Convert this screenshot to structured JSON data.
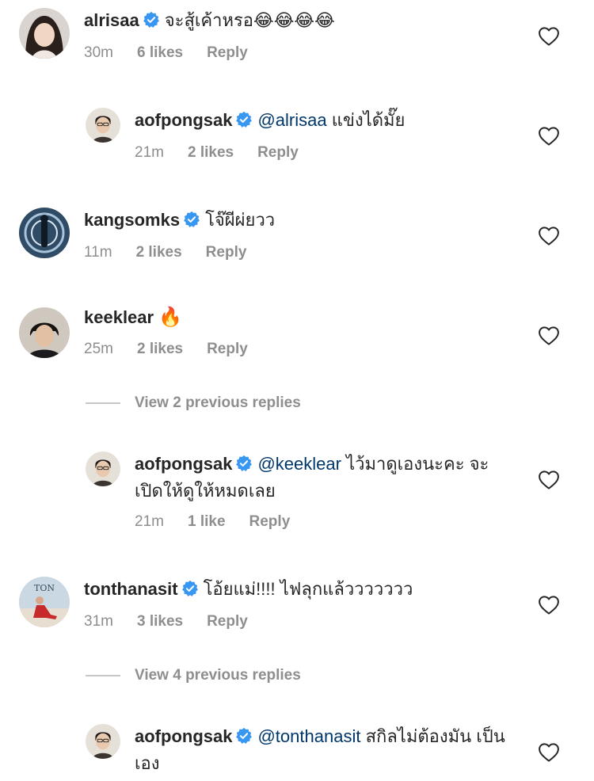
{
  "colors": {
    "text": "#262626",
    "secondary": "#8e8e8e",
    "mention": "#00376b",
    "verified": "#3897f0",
    "background": "#ffffff"
  },
  "comments": [
    {
      "username": "alrisaa",
      "verified": true,
      "text": "จะสู้เค้าหรอ😂😂😂😂",
      "time": "30m",
      "likes": "6 likes",
      "reply": "Reply"
    },
    {
      "username": "aofpongsak",
      "verified": true,
      "mention": "@alrisaa",
      "text": "แข่งได้มั๊ย",
      "time": "21m",
      "likes": "2 likes",
      "reply": "Reply"
    },
    {
      "username": "kangsomks",
      "verified": true,
      "text": "โจ๊ผีผ่ยวว",
      "time": "11m",
      "likes": "2 likes",
      "reply": "Reply"
    },
    {
      "username": "keeklear",
      "verified": false,
      "text": "🔥",
      "time": "25m",
      "likes": "2 likes",
      "reply": "Reply"
    },
    {
      "username": "aofpongsak",
      "verified": true,
      "mention": "@keeklear",
      "text": "ไว้มาดูเองนะคะ จะเปิดให้ดูให้หมดเลย",
      "time": "21m",
      "likes": "1 like",
      "reply": "Reply"
    },
    {
      "username": "tonthanasit",
      "verified": true,
      "text": "โอ้ยแม่!!!! ไฟลุกแล้ววววววว",
      "time": "31m",
      "likes": "3 likes",
      "reply": "Reply"
    },
    {
      "username": "aofpongsak",
      "verified": true,
      "mention": "@tonthanasit",
      "text": "สกิลไม่ต้องมัน เป็นเอง",
      "time": "",
      "likes": "",
      "reply": ""
    }
  ],
  "view_replies": [
    {
      "label": "View 2 previous replies"
    },
    {
      "label": "View 4 previous replies"
    }
  ],
  "avatar_texts": {
    "tonthanasit": "TON"
  }
}
